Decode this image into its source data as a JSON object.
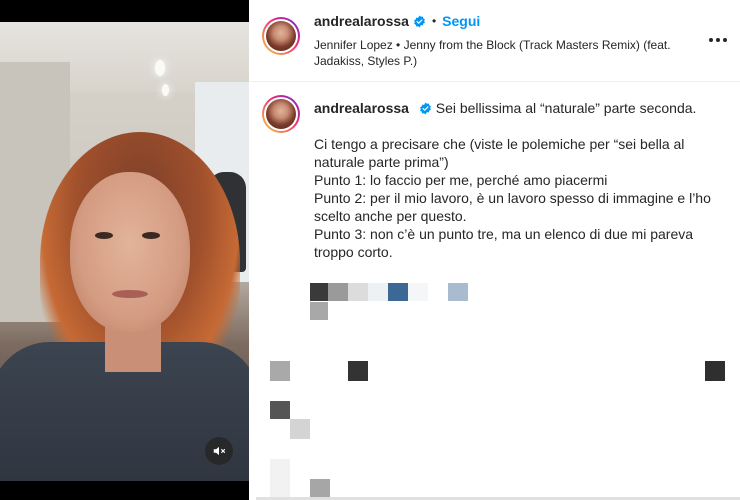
{
  "post": {
    "username": "andrealarossa",
    "follow_label": "Segui",
    "separator": "•",
    "music": "Jennifer Lopez • Jenny from the Block (Track Masters Remix) (feat. Jadakiss, Styles P.)"
  },
  "caption": {
    "username": "andrealarossa",
    "lines": [
      "Sei bellissima al “naturale” parte seconda.",
      "",
      "Ci tengo a precisare che (viste le polemiche per “sei bella al naturale parte prima”)",
      "Punto 1: lo faccio per me, perché amo piacermi",
      "Punto 2: per il mio lavoro, è un lavoro spesso di immagine e l’ho scelto anche per questo.",
      "Punto 3: non c’è un punto tre, ma un elenco di due mi pareva troppo corto."
    ]
  },
  "icons": {
    "verified": "verified-badge-icon",
    "more": "more-options-icon",
    "mute": "audio-muted-icon"
  },
  "colors": {
    "accent": "#0095f6",
    "text": "#262626"
  }
}
